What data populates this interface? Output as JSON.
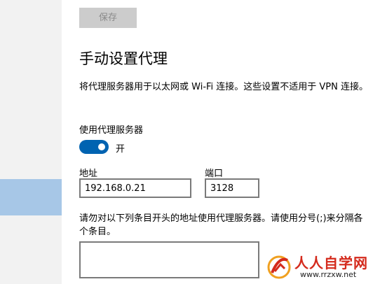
{
  "save_button": "保存",
  "title": "手动设置代理",
  "description": "将代理服务器用于以太网或 Wi-Fi 连接。这些设置不适用于 VPN 连接。",
  "proxy_toggle": {
    "label": "使用代理服务器",
    "state": "开",
    "on": true
  },
  "address": {
    "label": "地址",
    "value": "192.168.0.21"
  },
  "port": {
    "label": "端口",
    "value": "3128"
  },
  "exceptions": {
    "label": "请勿对以下列条目开头的地址使用代理服务器。请使用分号(;)来分隔各个条目。",
    "value": ""
  },
  "watermark": {
    "name": "人人自学网",
    "url": "www.rrzxw.net"
  },
  "colors": {
    "accent": "#0063b1",
    "sidebar_selected": "#a7c7e7",
    "watermark": "#d42a1c"
  }
}
